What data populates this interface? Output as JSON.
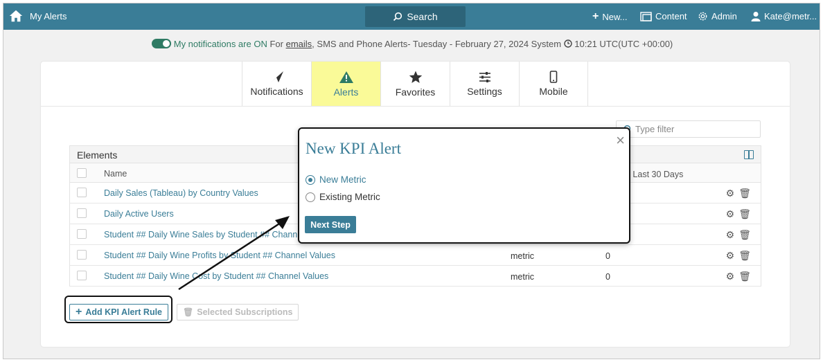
{
  "topbar": {
    "app_title": "My Alerts",
    "search_label": "Search",
    "new_label": "New...",
    "content_label": "Content",
    "admin_label": "Admin",
    "user_label": "Kate@metr..."
  },
  "notification_bar": {
    "status_text": "My notifications are ON",
    "for_text": "For",
    "emails_link": "emails",
    "rest_text": ", SMS and Phone Alerts- Tuesday - February 27, 2024 System",
    "time_text": "10:21 UTC(UTC +00:00)"
  },
  "tabs": [
    {
      "label": "Notifications",
      "icon": "paper-plane-icon",
      "active": false
    },
    {
      "label": "Alerts",
      "icon": "warning-icon",
      "active": true
    },
    {
      "label": "Favorites",
      "icon": "star-icon",
      "active": false
    },
    {
      "label": "Settings",
      "icon": "sliders-icon",
      "active": false
    },
    {
      "label": "Mobile",
      "icon": "mobile-icon",
      "active": false
    }
  ],
  "filter": {
    "placeholder": "Type filter"
  },
  "table": {
    "title": "Elements",
    "col_name": "Name",
    "col_count": "n Last 30 Days",
    "rows": [
      {
        "name": "Daily Sales (Tableau) by Country Values",
        "type": "",
        "count": ""
      },
      {
        "name": "Daily Active Users",
        "type": "",
        "count": ""
      },
      {
        "name": "Student ## Daily Wine Sales by Student ## Channe",
        "type": "",
        "count": ""
      },
      {
        "name": "Student ## Daily Wine Profits by Student ## Channel Values",
        "type": "metric",
        "count": "0"
      },
      {
        "name": "Student ## Daily Wine Cost by Student ## Channel Values",
        "type": "metric",
        "count": "0"
      }
    ]
  },
  "buttons": {
    "add_rule": "Add KPI Alert Rule",
    "selected_subs": "Selected Subscriptions"
  },
  "modal": {
    "title": "New KPI Alert",
    "option_new": "New Metric",
    "option_existing": "Existing Metric",
    "next_label": "Next Step",
    "close_symbol": "×"
  },
  "colors": {
    "brand": "#3a7d97",
    "active_tab": "#fafa98",
    "toggle_on": "#2f7b64"
  }
}
